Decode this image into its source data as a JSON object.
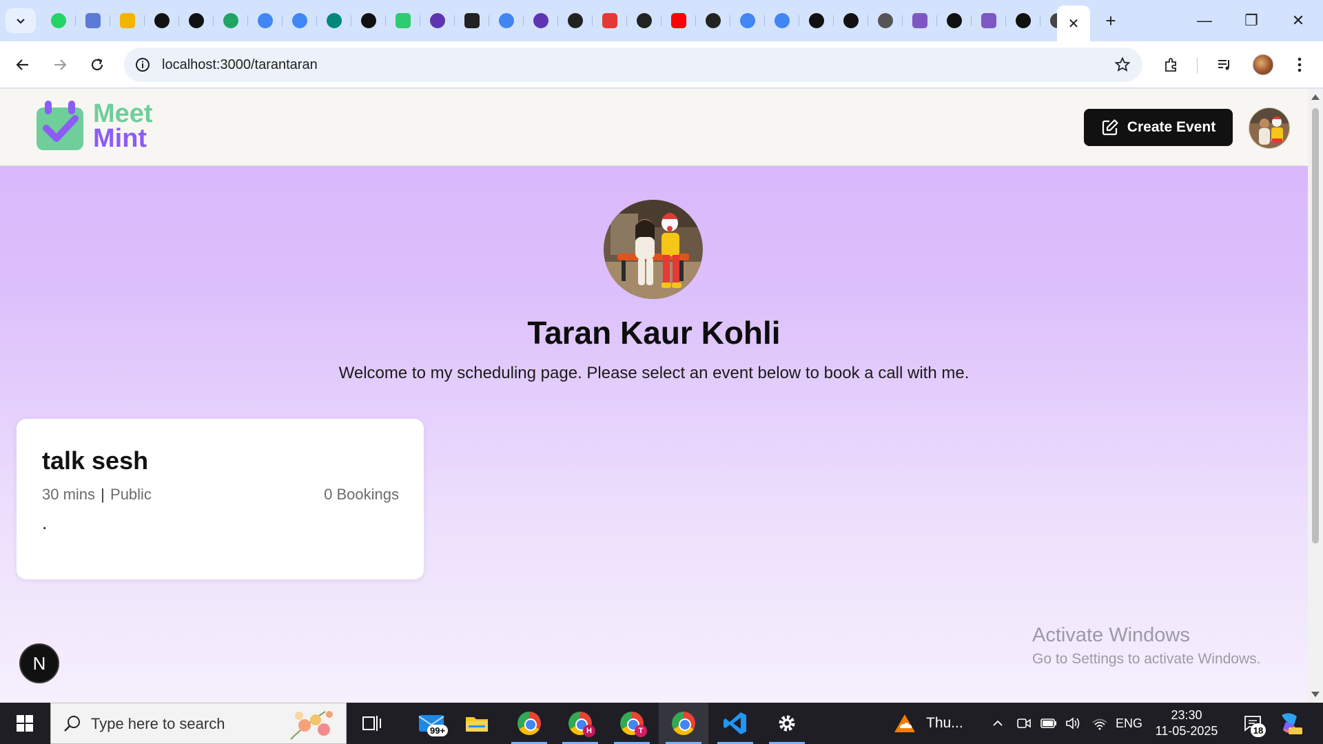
{
  "browser": {
    "pinned_tabs": [
      {
        "icon": "whatsapp-icon",
        "color": "#25d366",
        "glyph": ""
      },
      {
        "icon": "bird-logo-icon",
        "color": "#5b7bd5",
        "glyph": ""
      },
      {
        "icon": "slides-icon",
        "color": "#f4b400",
        "glyph": ""
      },
      {
        "icon": "leaf-logo-icon",
        "color": "#111111",
        "glyph": ""
      },
      {
        "icon": "openai-icon",
        "color": "#111111",
        "glyph": ""
      },
      {
        "icon": "google-drive-icon",
        "color": "#1fa463",
        "glyph": ""
      },
      {
        "icon": "google-docs-icon",
        "color": "#4285f4",
        "glyph": ""
      },
      {
        "icon": "google-docs-icon",
        "color": "#4285f4",
        "glyph": ""
      },
      {
        "icon": "google-meet-icon",
        "color": "#00897b",
        "glyph": ""
      },
      {
        "icon": "github-icon",
        "color": "#111111",
        "glyph": ""
      },
      {
        "icon": "app-logo-icon",
        "color": "#2ecc71",
        "glyph": ""
      },
      {
        "icon": "c-logo-icon",
        "color": "#5e35b1",
        "glyph": ""
      },
      {
        "icon": "pen-icon",
        "color": "#222222",
        "glyph": ""
      },
      {
        "icon": "google-icon",
        "color": "#4285f4",
        "glyph": ""
      },
      {
        "icon": "c-logo-icon",
        "color": "#5e35b1",
        "glyph": ""
      },
      {
        "icon": "prisma-icon",
        "color": "#222222",
        "glyph": ""
      },
      {
        "icon": "app-logo-icon",
        "color": "#e53935",
        "glyph": ""
      },
      {
        "icon": "prisma-icon",
        "color": "#222222",
        "glyph": ""
      },
      {
        "icon": "youtube-icon",
        "color": "#ff0000",
        "glyph": ""
      },
      {
        "icon": "prisma-icon",
        "color": "#222222",
        "glyph": ""
      },
      {
        "icon": "google-icon",
        "color": "#4285f4",
        "glyph": ""
      },
      {
        "icon": "google-icon",
        "color": "#4285f4",
        "glyph": ""
      },
      {
        "icon": "openai-icon",
        "color": "#111111",
        "glyph": ""
      },
      {
        "icon": "triangle-logo-icon",
        "color": "#111111",
        "glyph": ""
      },
      {
        "icon": "openai-icon",
        "color": "#555555",
        "glyph": ""
      },
      {
        "icon": "app-logo-icon",
        "color": "#7e57c2",
        "glyph": ""
      },
      {
        "icon": "triangle-logo-icon",
        "color": "#111111",
        "glyph": ""
      },
      {
        "icon": "app-logo-icon",
        "color": "#7e57c2",
        "glyph": ""
      },
      {
        "icon": "triangle-logo-icon",
        "color": "#111111",
        "glyph": ""
      },
      {
        "icon": "triangle-logo-icon",
        "color": "#444444",
        "glyph": ""
      }
    ],
    "url": "localhost:3000/tarantaran",
    "window_controls": {
      "minimize": "—",
      "restore": "❐",
      "close": "✕"
    }
  },
  "page": {
    "logo": {
      "line1": "Meet",
      "line2": "Mint"
    },
    "create_event_label": "Create Event",
    "profile": {
      "name": "Taran Kaur Kohli",
      "bio": "Welcome to my scheduling page. Please select an event below to book a call with me."
    },
    "events": [
      {
        "title": "talk sesh",
        "duration": "30 mins",
        "separator": "|",
        "visibility": "Public",
        "bookings": "0 Bookings",
        "description": "."
      }
    ],
    "dev_badge": "N",
    "watermark": {
      "title": "Activate Windows",
      "subtitle": "Go to Settings to activate Windows."
    }
  },
  "taskbar": {
    "search_placeholder": "Type here to search",
    "mail_badge": "99+",
    "chrome_profiles": [
      {
        "badge": "",
        "badge_color": ""
      },
      {
        "badge": "H",
        "badge_color": "#c2185b"
      },
      {
        "badge": "T",
        "badge_color": "#d81b60"
      },
      {
        "badge": "",
        "badge_color": ""
      }
    ],
    "weather": "Thu...",
    "language": "ENG",
    "time": "23:30",
    "date": "11-05-2025",
    "notifications": "18"
  },
  "colors": {
    "accent_green": "#6fce9a",
    "accent_purple": "#8b5cf6",
    "button_dark": "#111111"
  }
}
